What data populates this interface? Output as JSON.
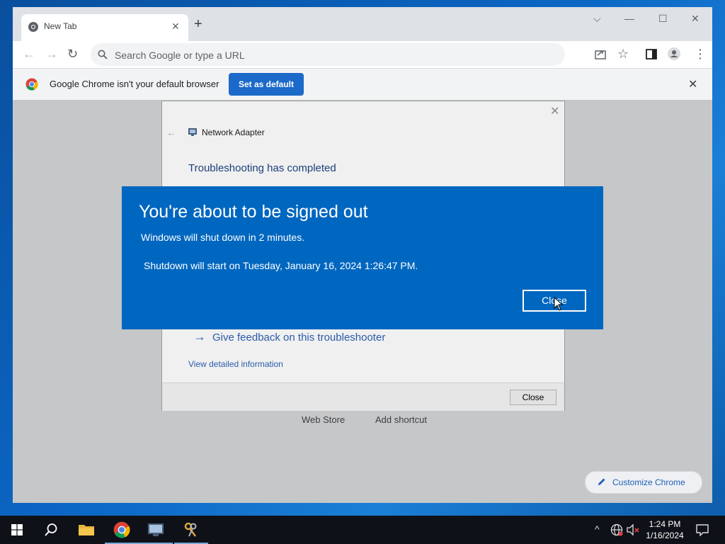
{
  "browser": {
    "tab_title": "New Tab",
    "omnibox_placeholder": "Search Google or type a URL",
    "infobar_text": "Google Chrome isn't your default browser",
    "infobar_button": "Set as default",
    "ntp_links": [
      "Web Store",
      "Add shortcut"
    ],
    "customize_label": "Customize Chrome"
  },
  "troubleshooter": {
    "breadcrumb": "Network Adapter",
    "heading": "Troubleshooting has completed",
    "feedback_link": "Give feedback on this troubleshooter",
    "details_link": "View detailed information",
    "close_button": "Close"
  },
  "signout_notice": {
    "title": "You're about to be signed out",
    "line1": "Windows will shut down in 2 minutes.",
    "line2": "Shutdown will start on Tuesday, January 16, 2024 1:26:47 PM.",
    "close_button": "Close"
  },
  "taskbar": {
    "time": "1:24 PM",
    "date": "1/16/2024"
  },
  "colors": {
    "notice_bg": "#0067c0",
    "chrome_blue": "#1b6ac9",
    "taskbar_bg": "#0e1117"
  }
}
